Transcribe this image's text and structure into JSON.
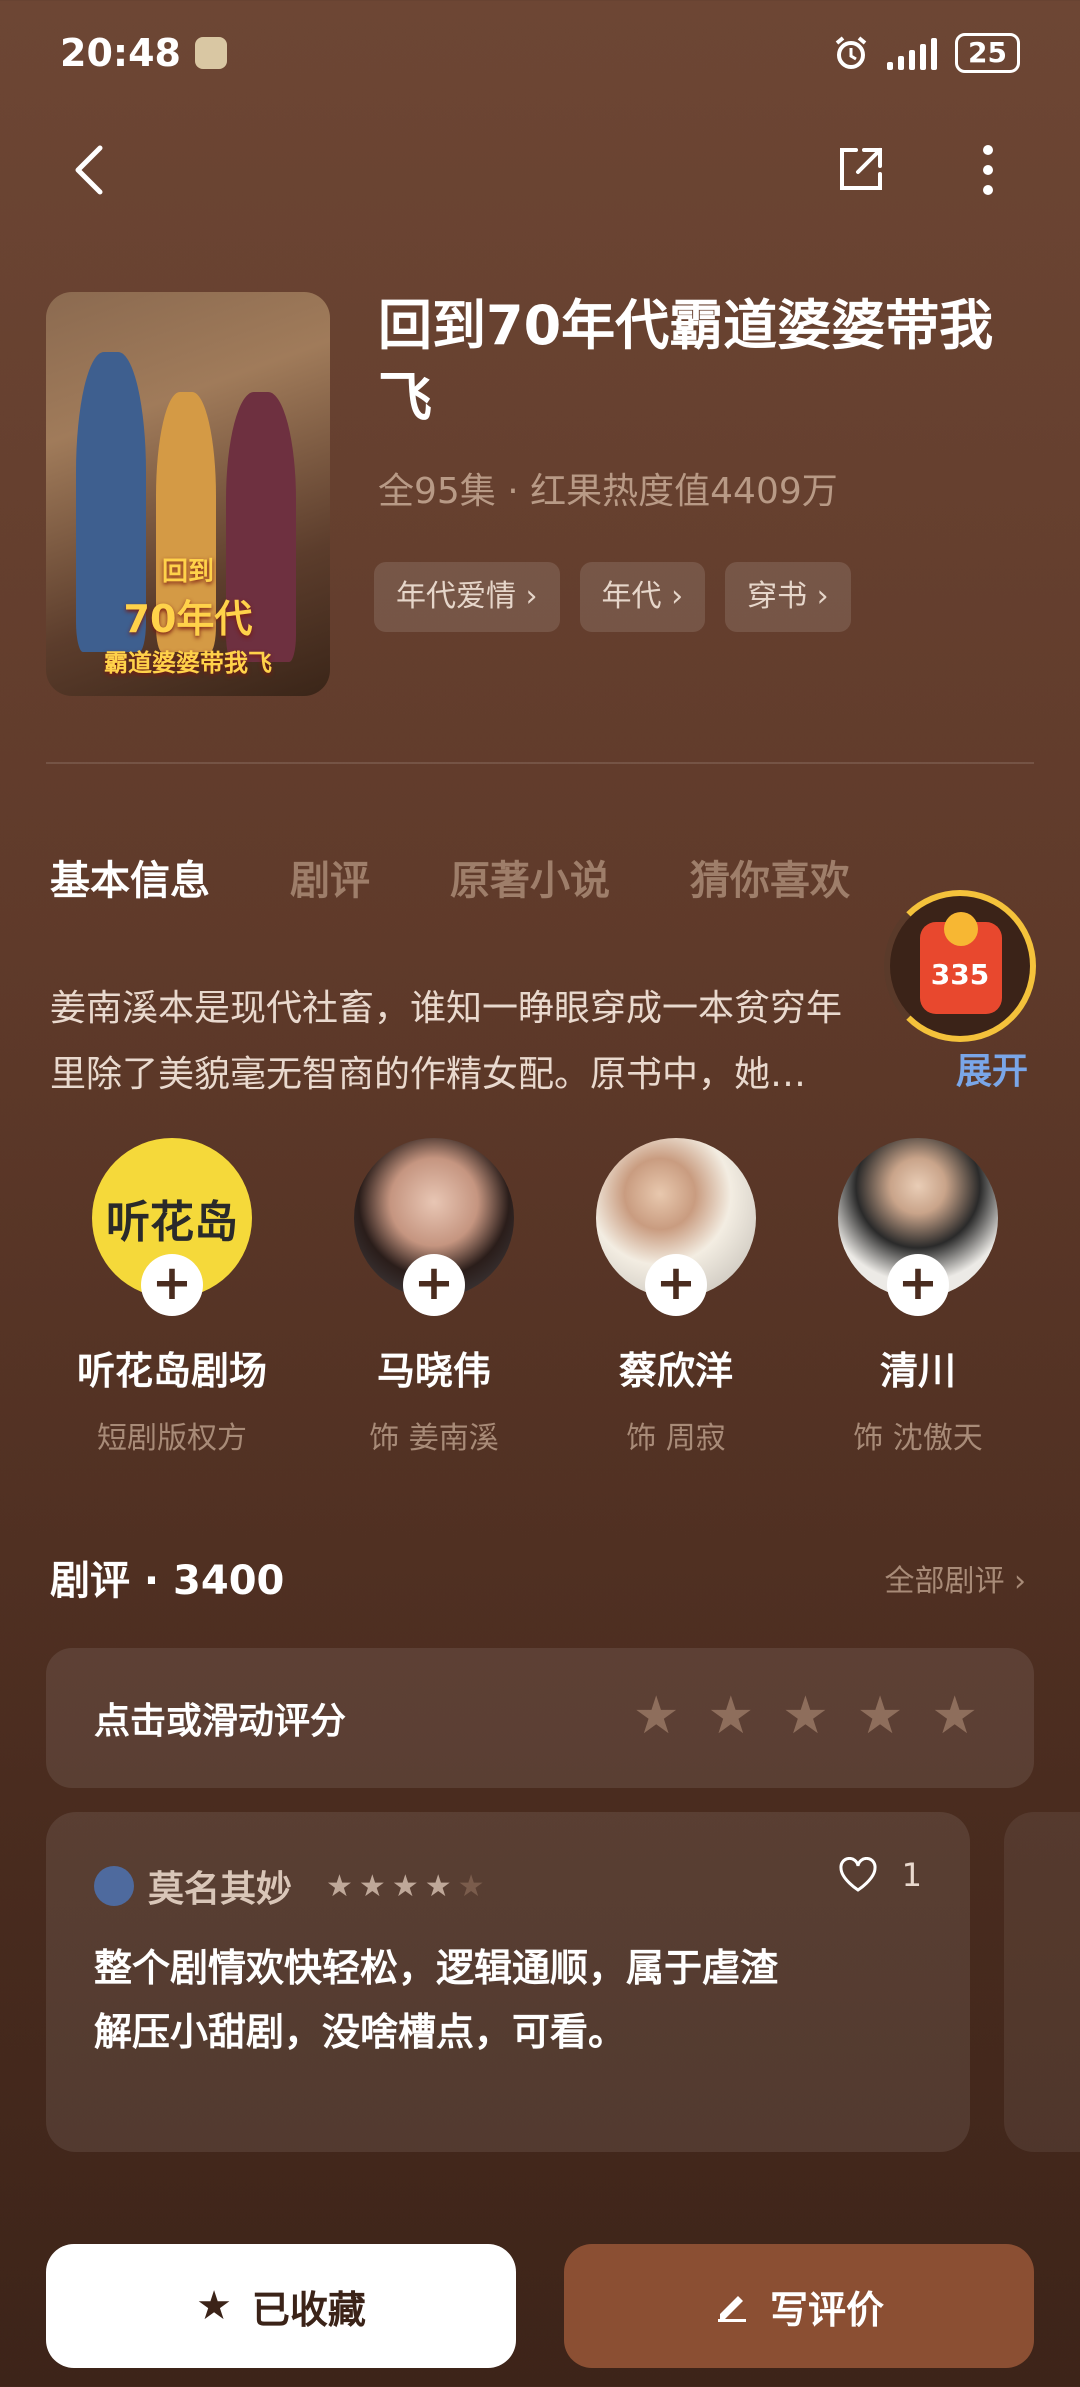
{
  "status": {
    "time": "20:48",
    "battery": "25"
  },
  "show": {
    "title": "回到70年代霸道婆婆带我飞",
    "meta": "全95集 · 红果热度值4409万",
    "tags": [
      "年代爱情 ›",
      "年代 ›",
      "穿书 ›"
    ],
    "poster_line1": "回到",
    "poster_line2": "70年代",
    "poster_line3": "霸道婆婆带我飞"
  },
  "tabs": [
    "基本信息",
    "剧评",
    "原著小说",
    "猜你喜欢"
  ],
  "red_packet": {
    "count": "335"
  },
  "description": {
    "line1": "姜南溪本是现代社畜，谁知一睁眼穿成一本贫穷年",
    "line2": "里除了美貌毫无智商的作精女配。原书中，她…",
    "expand": "展开"
  },
  "cast": [
    {
      "name": "听花岛剧场",
      "role": "短剧版权方",
      "logo": "听花岛"
    },
    {
      "name": "马晓伟",
      "role": "饰 姜南溪"
    },
    {
      "name": "蔡欣洋",
      "role": "饰 周寂"
    },
    {
      "name": "清川",
      "role": "饰 沈傲天"
    }
  ],
  "reviews": {
    "header": "剧评 · 3400",
    "all_link": "全部剧评 ›",
    "rate_prompt": "点击或滑动评分",
    "card": {
      "user": "莫名其妙",
      "rating": 4,
      "likes": "1",
      "text_line1": "整个剧情欢快轻松，逻辑通顺，属于虐渣",
      "text_line2": "解压小甜剧，没啥槽点，可看。"
    }
  },
  "buttons": {
    "favorite": "已收藏",
    "write": "写评价"
  },
  "colors": {
    "accent": "#8b4f33",
    "link": "#7aa6e8",
    "packet": "#e8482e"
  }
}
